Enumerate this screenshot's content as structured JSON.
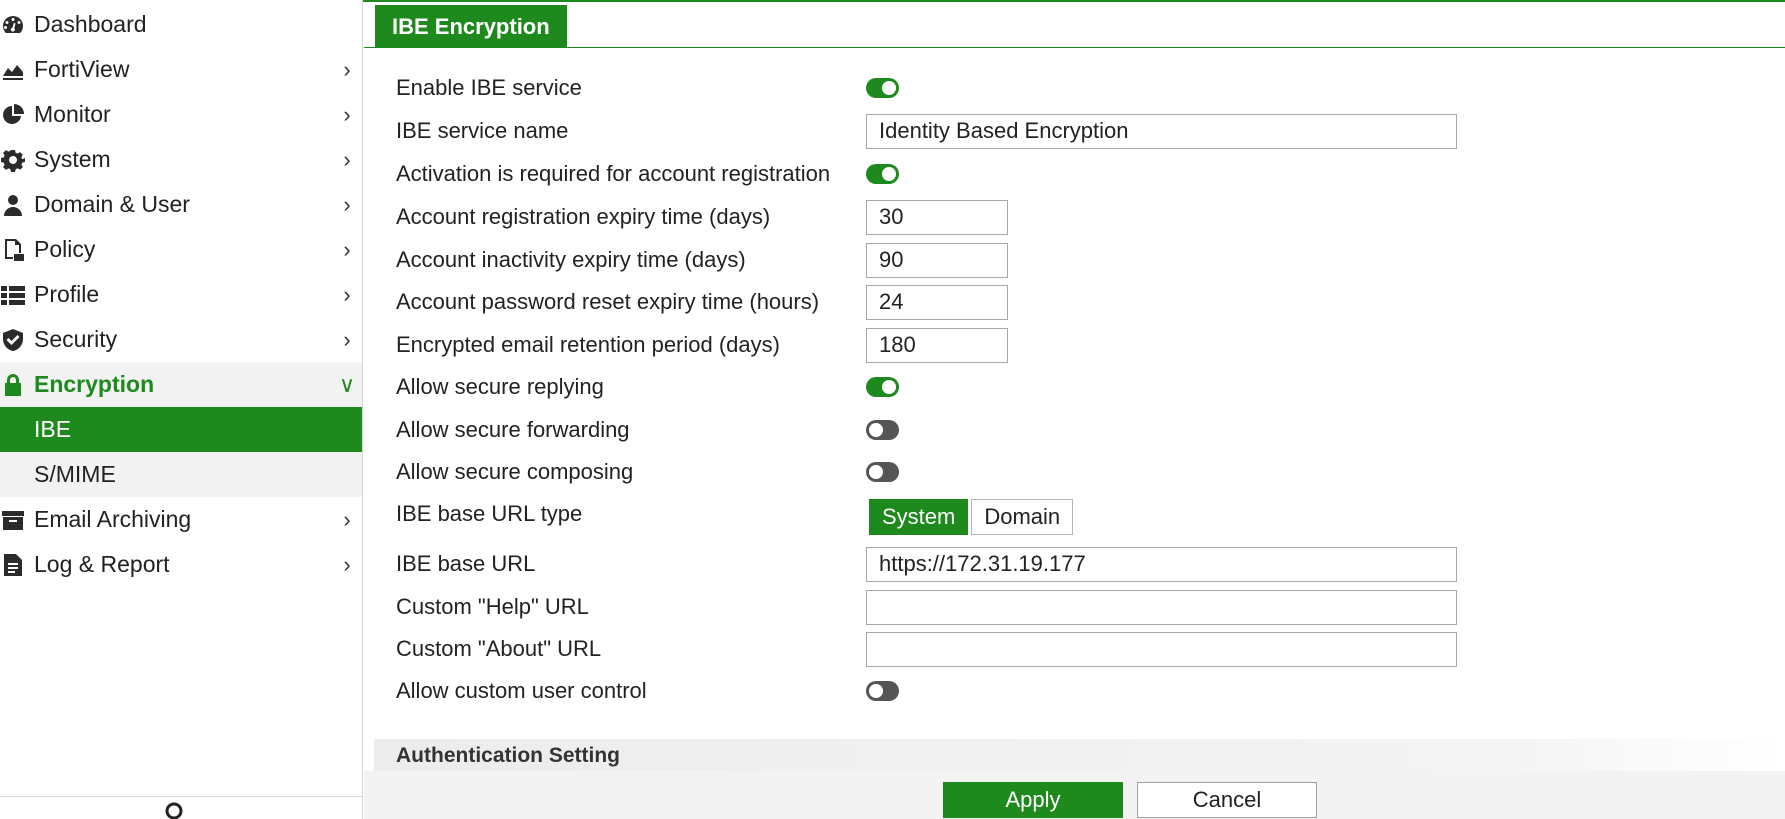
{
  "colors": {
    "accent": "#1e8a1e",
    "toggle_off": "#555555"
  },
  "sidebar": {
    "items": [
      {
        "label": "Dashboard",
        "icon": "dashboard-icon"
      },
      {
        "label": "FortiView",
        "icon": "chart-icon"
      },
      {
        "label": "Monitor",
        "icon": "pie-chart-icon"
      },
      {
        "label": "System",
        "icon": "gear-icon"
      },
      {
        "label": "Domain & User",
        "icon": "user-icon"
      },
      {
        "label": "Policy",
        "icon": "policy-icon"
      },
      {
        "label": "Profile",
        "icon": "list-icon"
      },
      {
        "label": "Security",
        "icon": "shield-icon"
      },
      {
        "label": "Encryption",
        "icon": "lock-icon"
      },
      {
        "label": "Email Archiving",
        "icon": "archive-icon"
      },
      {
        "label": "Log & Report",
        "icon": "report-icon"
      }
    ],
    "encryption_sub": [
      {
        "label": "IBE"
      },
      {
        "label": "S/MIME"
      }
    ]
  },
  "main": {
    "tab": "IBE Encryption",
    "form": {
      "enable_ibe_label": "Enable IBE service",
      "service_name_label": "IBE service name",
      "service_name_value": "Identity Based Encryption",
      "activation_label": "Activation is required for account registration",
      "reg_expiry_label": "Account registration expiry time (days)",
      "reg_expiry_value": "30",
      "inactivity_label": "Account inactivity expiry time (days)",
      "inactivity_value": "90",
      "pw_reset_label": "Account password reset expiry time (hours)",
      "pw_reset_value": "24",
      "retention_label": "Encrypted email retention period (days)",
      "retention_value": "180",
      "secure_reply_label": "Allow secure replying",
      "secure_forward_label": "Allow secure forwarding",
      "secure_compose_label": "Allow secure composing",
      "base_url_type_label": "IBE base URL type",
      "base_url_type_options": [
        "System",
        "Domain"
      ],
      "base_url_type_selected": "System",
      "base_url_label": "IBE base URL",
      "base_url_value": "https://172.31.19.177",
      "help_url_label": "Custom \"Help\" URL",
      "help_url_value": "",
      "about_url_label": "Custom \"About\" URL",
      "about_url_value": "",
      "custom_user_label": "Allow custom user control",
      "toggles": {
        "enable_ibe": true,
        "activation": true,
        "secure_reply": true,
        "secure_forward": false,
        "secure_compose": false,
        "custom_user": false
      }
    },
    "section_title": "Authentication Setting",
    "apply_label": "Apply",
    "cancel_label": "Cancel"
  }
}
